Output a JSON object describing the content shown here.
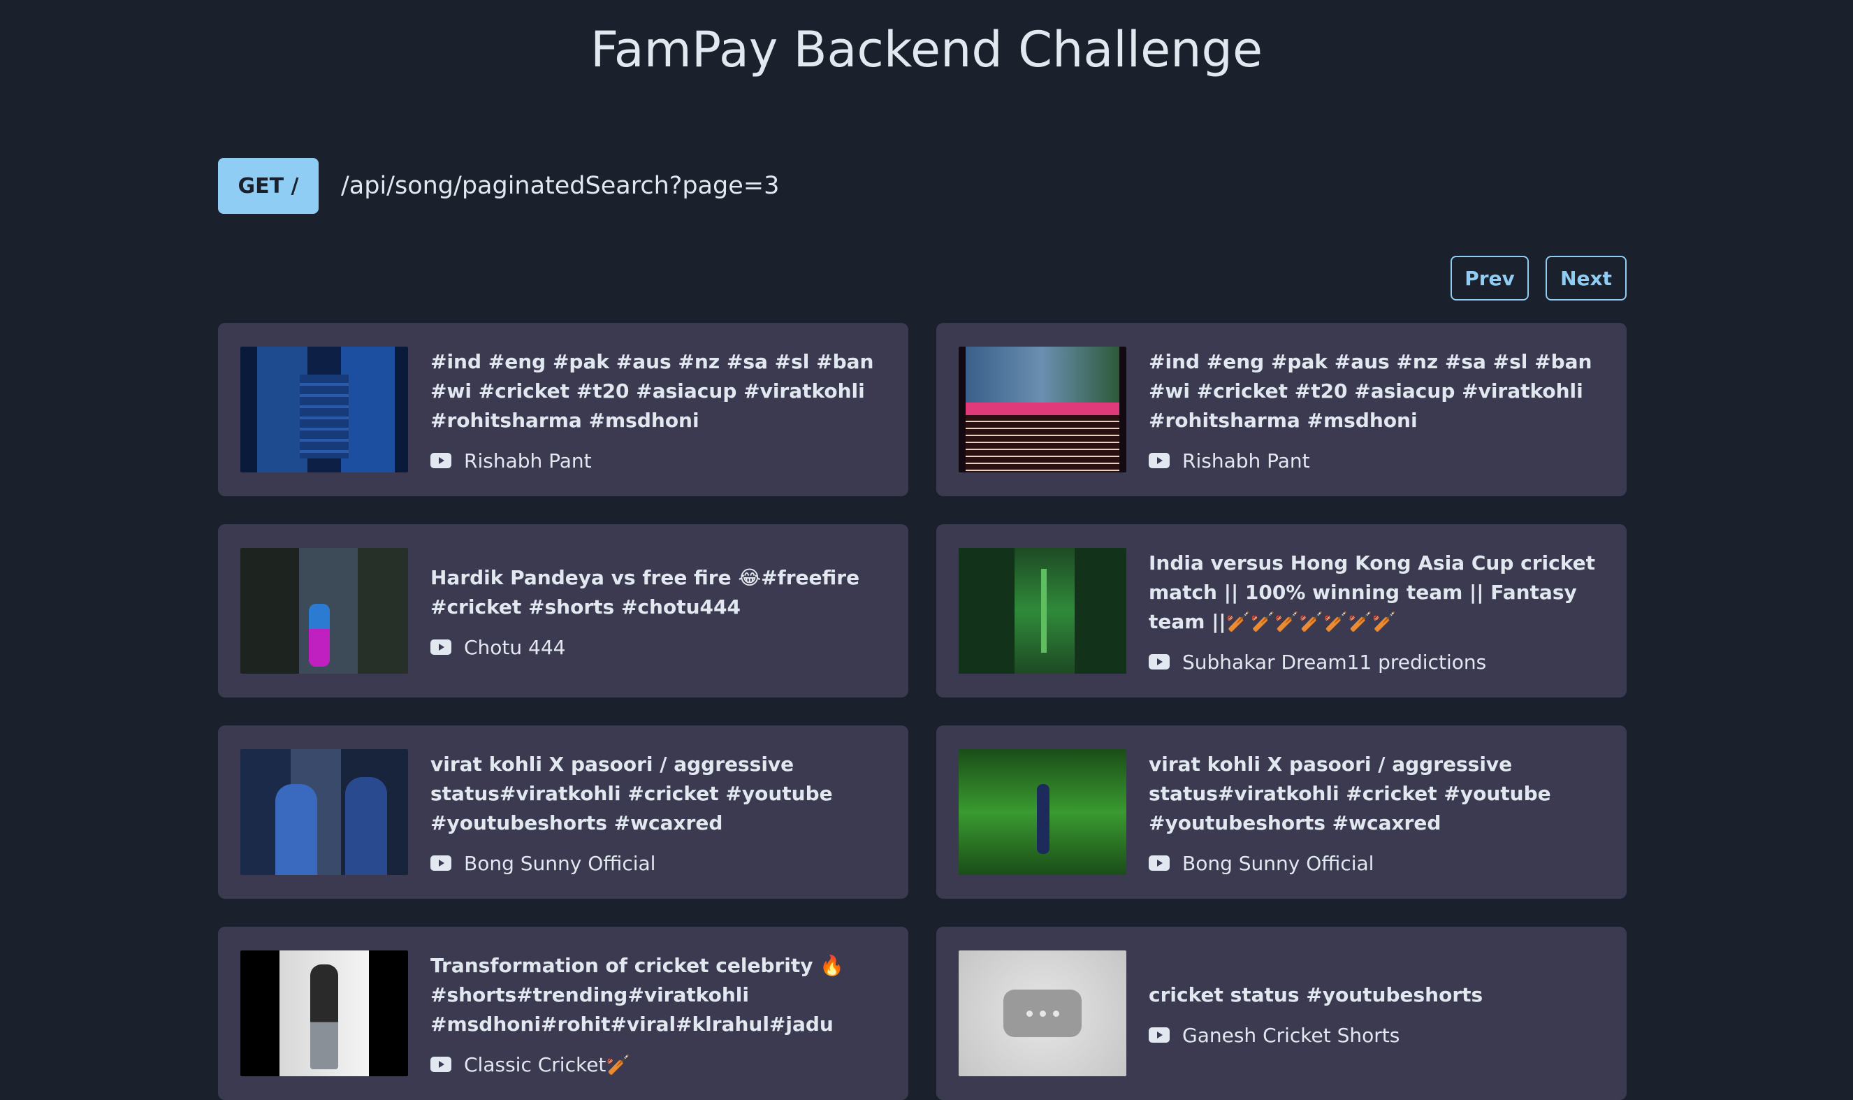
{
  "page": {
    "title": "FamPay Backend Challenge"
  },
  "endpoint": {
    "method": "GET /",
    "path": "/api/song/paginatedSearch?page=3"
  },
  "pager": {
    "prev_label": "Prev",
    "next_label": "Next"
  },
  "cards": [
    {
      "title": "#ind #eng #pak #aus #nz #sa #sl #ban #wi #cricket #t20 #asiacup #viratkohli #rohitsharma #msdhoni",
      "channel": "Rishabh Pant"
    },
    {
      "title": "#ind #eng #pak #aus #nz #sa #sl #ban #wi #cricket #t20 #asiacup #viratkohli #rohitsharma #msdhoni",
      "channel": "Rishabh Pant"
    },
    {
      "title": "Hardik Pandeya vs free fire 😂#freefire #cricket #shorts #chotu444",
      "channel": "Chotu 444"
    },
    {
      "title": "India versus Hong Kong Asia Cup cricket match || 100% winning team || Fantasy team ||🏏🏏🏏🏏🏏🏏🏏",
      "channel": "Subhakar Dream11 predictions"
    },
    {
      "title": "virat kohli X pasoori / aggressive status#viratkohli #cricket #youtube #youtubeshorts #wcaxred",
      "channel": "Bong Sunny Official"
    },
    {
      "title": "virat kohli X pasoori / aggressive status#viratkohli #cricket #youtube #youtubeshorts #wcaxred",
      "channel": "Bong Sunny Official"
    },
    {
      "title": "Transformation of cricket celebrity 🔥 #shorts#trending#viratkohli #msdhoni#rohit#viral#klrahul#jadu",
      "channel": "Classic Cricket🏏"
    },
    {
      "title": "cricket status #youtubeshorts",
      "channel": "Ganesh Cricket Shorts"
    }
  ]
}
